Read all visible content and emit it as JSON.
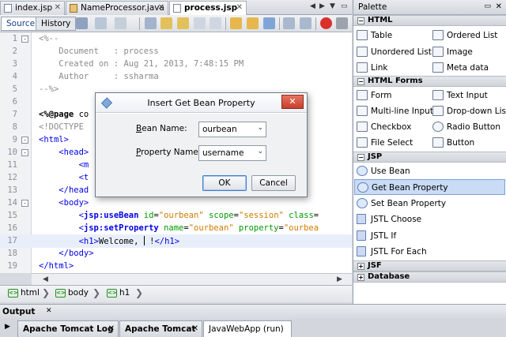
{
  "file_tabs": [
    {
      "label": "index.jsp",
      "kind": "jsp",
      "active": false
    },
    {
      "label": "NameProcessor.java",
      "kind": "java",
      "active": false
    },
    {
      "label": "process.jsp",
      "kind": "jsp",
      "active": true
    }
  ],
  "editor_toolbar": {
    "source_tab": "Source",
    "history_tab": "History"
  },
  "code_lines": [
    {
      "n": "1",
      "fold": "-",
      "html": "<span class='c-cmt'>&lt;%--</span>"
    },
    {
      "n": "2",
      "fold": "",
      "html": "<span class='c-cmt'>    Document   : process</span>"
    },
    {
      "n": "3",
      "fold": "",
      "html": "<span class='c-cmt'>    Created on : Aug 21, 2013, 7:48:15 PM</span>"
    },
    {
      "n": "4",
      "fold": "",
      "html": "<span class='c-cmt'>    Author     : ssharma</span>"
    },
    {
      "n": "5",
      "fold": "",
      "html": "<span class='c-cmt'>--%&gt;</span>"
    },
    {
      "n": "6",
      "fold": "",
      "html": ""
    },
    {
      "n": "7",
      "fold": "",
      "html": "<span class='c-dir'>&lt;%@page</span> co                                    <span class='c-str'>F-8\"</span><span class='c-dir'>%&gt;</span>"
    },
    {
      "n": "8",
      "fold": "",
      "html": "<span class='c-cmt'>&lt;!DOCTYPE</span>"
    },
    {
      "n": "9",
      "fold": "-",
      "html": "<span class='c-tag'>&lt;html&gt;</span>"
    },
    {
      "n": "10",
      "fold": "-",
      "html": "    <span class='c-tag'>&lt;head&gt;</span>"
    },
    {
      "n": "11",
      "fold": "",
      "html": "        <span class='c-tag'>&lt;m</span>                                  <span class='c-attr'>=</span><span class='c-str'>\"text/ht</span>"
    },
    {
      "n": "12",
      "fold": "",
      "html": "        <span class='c-tag'>&lt;t</span>"
    },
    {
      "n": "13",
      "fold": "",
      "html": "    <span class='c-tag'>&lt;/head</span>"
    },
    {
      "n": "14",
      "fold": "-",
      "html": "    <span class='c-tag'>&lt;body&gt;</span>"
    },
    {
      "n": "15",
      "fold": "",
      "html": "        <span class='c-tag'>&lt;<b>jsp:useBean</b></span> <span class='c-attr'>id</span>=<span class='c-str'>\"ourbean\"</span> <span class='c-attr'>scope</span>=<span class='c-str'>\"session\"</span> <span class='c-attr'>class</span>="
    },
    {
      "n": "16",
      "fold": "",
      "html": "        <span class='c-tag'>&lt;<b>jsp:setProperty</b></span> <span class='c-attr'>name</span>=<span class='c-str'>\"ourbean\"</span> <span class='c-attr'>property</span>=<span class='c-str'>\"ourbea</span>"
    },
    {
      "n": "17",
      "fold": "",
      "hl": true,
      "html": "        <span class='c-tag'>&lt;h1&gt;</span>Welcome, <span class='caret'></span> !<span class='c-tag'>&lt;/h1&gt;</span>"
    },
    {
      "n": "18",
      "fold": "",
      "html": "    <span class='c-tag'>&lt;/body&gt;</span>"
    },
    {
      "n": "19",
      "fold": "",
      "html": "<span class='c-tag'>&lt;/html&gt;</span>"
    }
  ],
  "breadcrumb": [
    "html",
    "body",
    "h1"
  ],
  "output": {
    "title": "Output",
    "tabs": [
      {
        "label": "Apache Tomcat Log",
        "active": false
      },
      {
        "label": "Apache Tomcat",
        "active": false
      },
      {
        "label": "JavaWebApp (run)",
        "active": true
      }
    ]
  },
  "palette": {
    "title": "Palette",
    "categories": {
      "html": "HTML",
      "html_forms": "HTML Forms",
      "jsp": "JSP",
      "jsf": "JSF",
      "database": "Database"
    },
    "html_items": [
      "Table",
      "Ordered List",
      "Unordered List",
      "Image",
      "Link",
      "Meta data"
    ],
    "form_items": [
      "Form",
      "Text Input",
      "Multi-line Input",
      "Drop-down List",
      "Checkbox",
      "Radio Button",
      "File Select",
      "Button"
    ],
    "jsp_items": [
      "Use Bean",
      "Get Bean Property",
      "Set Bean Property",
      "JSTL Choose",
      "JSTL If",
      "JSTL For Each"
    ],
    "selected": "Get Bean Property"
  },
  "dialog": {
    "title": "Insert Get Bean Property",
    "bean_name_label_accel": "B",
    "bean_name_label_rest": "ean Name:",
    "bean_name_value": "ourbean",
    "property_name_label_accel": "P",
    "property_name_label_rest": "roperty Name:",
    "property_name_value": "username",
    "ok_label": "OK",
    "cancel_label": "Cancel",
    "close_glyph": "✕"
  }
}
